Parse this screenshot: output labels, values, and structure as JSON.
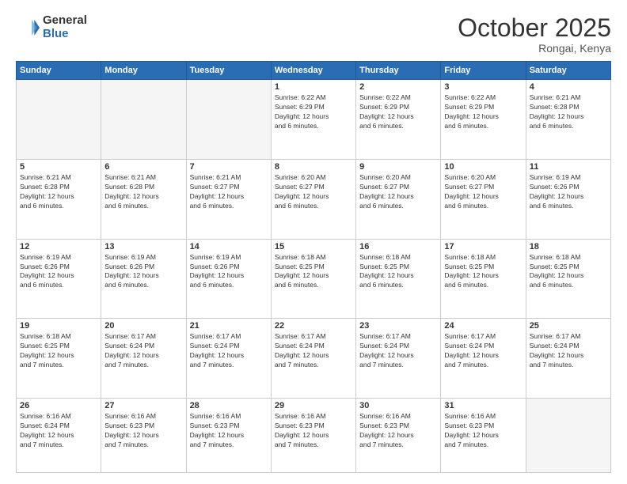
{
  "header": {
    "logo_general": "General",
    "logo_blue": "Blue",
    "month": "October 2025",
    "location": "Rongai, Kenya"
  },
  "weekdays": [
    "Sunday",
    "Monday",
    "Tuesday",
    "Wednesday",
    "Thursday",
    "Friday",
    "Saturday"
  ],
  "weeks": [
    [
      {
        "day": "",
        "info": ""
      },
      {
        "day": "",
        "info": ""
      },
      {
        "day": "",
        "info": ""
      },
      {
        "day": "1",
        "info": "Sunrise: 6:22 AM\nSunset: 6:29 PM\nDaylight: 12 hours\nand 6 minutes."
      },
      {
        "day": "2",
        "info": "Sunrise: 6:22 AM\nSunset: 6:29 PM\nDaylight: 12 hours\nand 6 minutes."
      },
      {
        "day": "3",
        "info": "Sunrise: 6:22 AM\nSunset: 6:29 PM\nDaylight: 12 hours\nand 6 minutes."
      },
      {
        "day": "4",
        "info": "Sunrise: 6:21 AM\nSunset: 6:28 PM\nDaylight: 12 hours\nand 6 minutes."
      }
    ],
    [
      {
        "day": "5",
        "info": "Sunrise: 6:21 AM\nSunset: 6:28 PM\nDaylight: 12 hours\nand 6 minutes."
      },
      {
        "day": "6",
        "info": "Sunrise: 6:21 AM\nSunset: 6:28 PM\nDaylight: 12 hours\nand 6 minutes."
      },
      {
        "day": "7",
        "info": "Sunrise: 6:21 AM\nSunset: 6:27 PM\nDaylight: 12 hours\nand 6 minutes."
      },
      {
        "day": "8",
        "info": "Sunrise: 6:20 AM\nSunset: 6:27 PM\nDaylight: 12 hours\nand 6 minutes."
      },
      {
        "day": "9",
        "info": "Sunrise: 6:20 AM\nSunset: 6:27 PM\nDaylight: 12 hours\nand 6 minutes."
      },
      {
        "day": "10",
        "info": "Sunrise: 6:20 AM\nSunset: 6:27 PM\nDaylight: 12 hours\nand 6 minutes."
      },
      {
        "day": "11",
        "info": "Sunrise: 6:19 AM\nSunset: 6:26 PM\nDaylight: 12 hours\nand 6 minutes."
      }
    ],
    [
      {
        "day": "12",
        "info": "Sunrise: 6:19 AM\nSunset: 6:26 PM\nDaylight: 12 hours\nand 6 minutes."
      },
      {
        "day": "13",
        "info": "Sunrise: 6:19 AM\nSunset: 6:26 PM\nDaylight: 12 hours\nand 6 minutes."
      },
      {
        "day": "14",
        "info": "Sunrise: 6:19 AM\nSunset: 6:26 PM\nDaylight: 12 hours\nand 6 minutes."
      },
      {
        "day": "15",
        "info": "Sunrise: 6:18 AM\nSunset: 6:25 PM\nDaylight: 12 hours\nand 6 minutes."
      },
      {
        "day": "16",
        "info": "Sunrise: 6:18 AM\nSunset: 6:25 PM\nDaylight: 12 hours\nand 6 minutes."
      },
      {
        "day": "17",
        "info": "Sunrise: 6:18 AM\nSunset: 6:25 PM\nDaylight: 12 hours\nand 6 minutes."
      },
      {
        "day": "18",
        "info": "Sunrise: 6:18 AM\nSunset: 6:25 PM\nDaylight: 12 hours\nand 6 minutes."
      }
    ],
    [
      {
        "day": "19",
        "info": "Sunrise: 6:18 AM\nSunset: 6:25 PM\nDaylight: 12 hours\nand 7 minutes."
      },
      {
        "day": "20",
        "info": "Sunrise: 6:17 AM\nSunset: 6:24 PM\nDaylight: 12 hours\nand 7 minutes."
      },
      {
        "day": "21",
        "info": "Sunrise: 6:17 AM\nSunset: 6:24 PM\nDaylight: 12 hours\nand 7 minutes."
      },
      {
        "day": "22",
        "info": "Sunrise: 6:17 AM\nSunset: 6:24 PM\nDaylight: 12 hours\nand 7 minutes."
      },
      {
        "day": "23",
        "info": "Sunrise: 6:17 AM\nSunset: 6:24 PM\nDaylight: 12 hours\nand 7 minutes."
      },
      {
        "day": "24",
        "info": "Sunrise: 6:17 AM\nSunset: 6:24 PM\nDaylight: 12 hours\nand 7 minutes."
      },
      {
        "day": "25",
        "info": "Sunrise: 6:17 AM\nSunset: 6:24 PM\nDaylight: 12 hours\nand 7 minutes."
      }
    ],
    [
      {
        "day": "26",
        "info": "Sunrise: 6:16 AM\nSunset: 6:24 PM\nDaylight: 12 hours\nand 7 minutes."
      },
      {
        "day": "27",
        "info": "Sunrise: 6:16 AM\nSunset: 6:23 PM\nDaylight: 12 hours\nand 7 minutes."
      },
      {
        "day": "28",
        "info": "Sunrise: 6:16 AM\nSunset: 6:23 PM\nDaylight: 12 hours\nand 7 minutes."
      },
      {
        "day": "29",
        "info": "Sunrise: 6:16 AM\nSunset: 6:23 PM\nDaylight: 12 hours\nand 7 minutes."
      },
      {
        "day": "30",
        "info": "Sunrise: 6:16 AM\nSunset: 6:23 PM\nDaylight: 12 hours\nand 7 minutes."
      },
      {
        "day": "31",
        "info": "Sunrise: 6:16 AM\nSunset: 6:23 PM\nDaylight: 12 hours\nand 7 minutes."
      },
      {
        "day": "",
        "info": ""
      }
    ]
  ]
}
